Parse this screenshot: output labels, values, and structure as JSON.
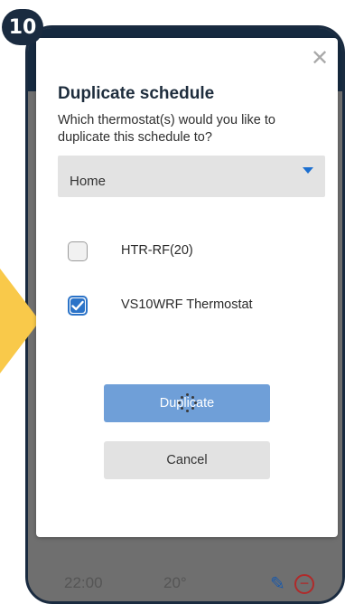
{
  "step_badge": "10",
  "modal": {
    "title": "Duplicate schedule",
    "subtitle": "Which thermostat(s) would you like to duplicate this schedule to?",
    "select": {
      "value": "Home"
    },
    "options": [
      {
        "label": "HTR-RF(20)",
        "checked": false
      },
      {
        "label": "VS10WRF Thermostat",
        "checked": true
      }
    ],
    "duplicate_label": "Duplicate",
    "cancel_label": "Cancel"
  },
  "background_row": {
    "time": "22:00",
    "temp": "20°"
  },
  "colors": {
    "accent": "#2b73c8",
    "primary_button": "#6f9fd8",
    "header": "#162a40",
    "highlight_arrow": "#f9c94a",
    "delete": "#b02a2a"
  },
  "icons": [
    "close-icon",
    "caret-down-icon",
    "checkmark-icon",
    "loading-spinner-icon",
    "pencil-icon",
    "remove-icon"
  ]
}
